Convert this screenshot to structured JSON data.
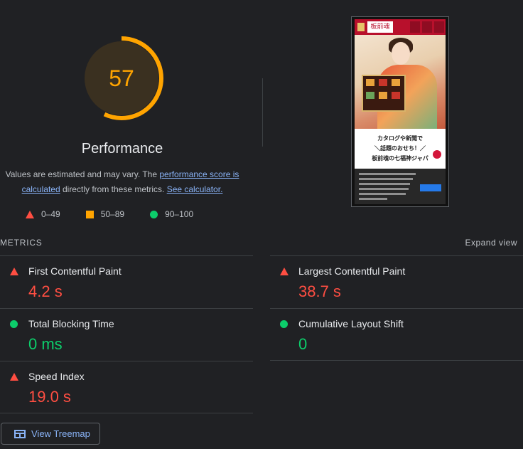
{
  "gauge": {
    "score": "57",
    "title": "Performance",
    "score_fraction": 0.57,
    "color": "#ffa400"
  },
  "description": {
    "prefix": "Values are estimated and may vary. The ",
    "link1": "performance score is calculated",
    "middle": " directly from these metrics. ",
    "link2": "See calculator."
  },
  "legend": [
    {
      "label": "0–49",
      "shape": "triangle",
      "color": "#ff4e42"
    },
    {
      "label": "50–89",
      "shape": "square",
      "color": "#ffa400"
    },
    {
      "label": "90–100",
      "shape": "circle",
      "color": "#0cce6b"
    }
  ],
  "screenshot": {
    "logo_text": "板前魂",
    "headline_lines": [
      "カタログや新聞で",
      "＼話題のおせち！／",
      "板前魂の七福神ジャパ"
    ]
  },
  "metrics_section": {
    "label": "METRICS",
    "expand_label": "Expand view"
  },
  "metrics": [
    {
      "name": "First Contentful Paint",
      "value": "4.2 s",
      "status": "poor"
    },
    {
      "name": "Largest Contentful Paint",
      "value": "38.7 s",
      "status": "poor"
    },
    {
      "name": "Total Blocking Time",
      "value": "0 ms",
      "status": "good"
    },
    {
      "name": "Cumulative Layout Shift",
      "value": "0",
      "status": "good"
    },
    {
      "name": "Speed Index",
      "value": "19.0 s",
      "status": "poor"
    }
  ],
  "treemap": {
    "label": "View Treemap",
    "icon": "treemap-icon"
  }
}
